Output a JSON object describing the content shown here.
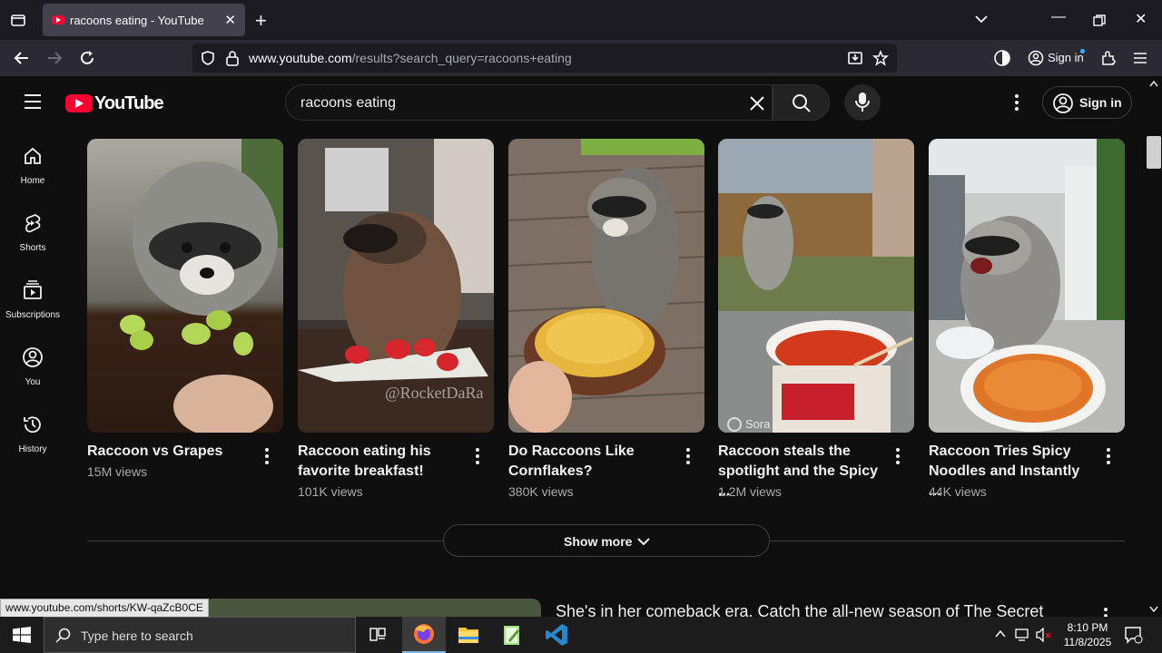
{
  "browser": {
    "tab_title": "racoons eating - YouTube",
    "url_host": "www.youtube.com",
    "url_path": "/results?search_query=racoons+eating",
    "sign_in": "Sign in"
  },
  "youtube": {
    "logo": "YouTube",
    "search_query": "racoons eating",
    "sign_in": "Sign in",
    "guide": [
      {
        "label": "Home",
        "icon": "home-icon"
      },
      {
        "label": "Shorts",
        "icon": "shorts-icon"
      },
      {
        "label": "Subscriptions",
        "icon": "subscriptions-icon"
      },
      {
        "label": "You",
        "icon": "you-icon"
      },
      {
        "label": "History",
        "icon": "history-icon"
      }
    ],
    "shorts": [
      {
        "title": "Raccoon vs Grapes",
        "views": "15M views"
      },
      {
        "title": "Raccoon eating his favorite breakfast!",
        "views": "101K views"
      },
      {
        "title": "Do Raccoons Like Cornflakes?",
        "views": "380K views"
      },
      {
        "title": "Raccoon steals the spotlight and the Spicy ...",
        "views": "1.2M views"
      },
      {
        "title": "Raccoon Tries Spicy Noodles and Instantly ...",
        "views": "44K views"
      }
    ],
    "thumb_overlays": {
      "watermark2": "@RocketDaRa",
      "watermark4": "Sora"
    },
    "show_more": "Show more",
    "next_title": "She's in her comeback era. Catch the all-new season of The Secret"
  },
  "status_url": "www.youtube.com/shorts/KW-qaZcB0CE",
  "taskbar": {
    "search_placeholder": "Type here to search",
    "time": "8:10 PM",
    "date": "11/8/2025"
  }
}
